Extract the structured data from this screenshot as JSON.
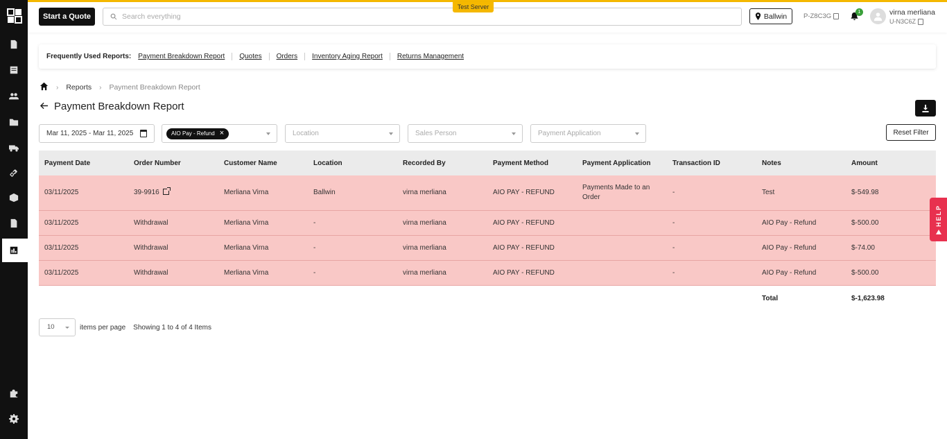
{
  "header": {
    "start_quote_label": "Start a Quote",
    "search_placeholder": "Search everything",
    "server_badge": "Test Server",
    "location": "Ballwin",
    "org_code": "P-Z8C3G",
    "notification_count": "1",
    "user_name": "virna merliana",
    "user_code": "U-N3C6Z"
  },
  "frequent_reports": {
    "label": "Frequently Used Reports:",
    "links": [
      "Payment Breakdown Report",
      "Quotes",
      "Orders",
      "Inventory Aging Report",
      "Returns Management"
    ]
  },
  "breadcrumb": {
    "items": [
      "Reports",
      "Payment Breakdown Report"
    ]
  },
  "page": {
    "title": "Payment Breakdown Report"
  },
  "filters": {
    "date_range": "Mar 11, 2025 - Mar 11, 2025",
    "payment_app_chip": "AIO Pay - Refund",
    "location_placeholder": "Location",
    "sales_person_placeholder": "Sales Person",
    "payment_application_placeholder": "Payment Application",
    "reset_label": "Reset Filter"
  },
  "table": {
    "columns": [
      "Payment Date",
      "Order Number",
      "Customer Name",
      "Location",
      "Recorded By",
      "Payment Method",
      "Payment Application",
      "Transaction ID",
      "Notes",
      "Amount"
    ],
    "rows": [
      [
        "03/11/2025",
        "39-9916",
        "Merliana Virna",
        "Ballwin",
        "virna merliana",
        "AIO PAY - REFUND",
        "Payments Made to an Order",
        "-",
        "Test",
        "$-549.98"
      ],
      [
        "03/11/2025",
        "Withdrawal",
        "Merliana Virna",
        "-",
        "virna merliana",
        "AIO PAY - REFUND",
        "",
        "-",
        "AIO Pay - Refund",
        "$-500.00"
      ],
      [
        "03/11/2025",
        "Withdrawal",
        "Merliana Virna",
        "-",
        "virna merliana",
        "AIO PAY - REFUND",
        "",
        "-",
        "AIO Pay - Refund",
        "$-74.00"
      ],
      [
        "03/11/2025",
        "Withdrawal",
        "Merliana Virna",
        "-",
        "virna merliana",
        "AIO PAY - REFUND",
        "",
        "-",
        "AIO Pay - Refund",
        "$-500.00"
      ]
    ],
    "total_label": "Total",
    "total_value": "$-1,623.98"
  },
  "pagination": {
    "per_page": "10",
    "per_page_label": "items per page",
    "showing": "Showing 1 to 4 of 4 Items"
  },
  "help_label": "HELP",
  "colors": {
    "accent": "#f5b800",
    "row_highlight": "#f9c8c6",
    "help": "#e8314f",
    "sidebar": "#111111"
  },
  "sidebar_icons": [
    "quote-icon",
    "ledger-icon",
    "customers-icon",
    "folder-icon",
    "truck-icon",
    "link-icon",
    "box-icon",
    "document-icon",
    "reports-icon",
    "puzzle-icon",
    "settings-icon"
  ]
}
